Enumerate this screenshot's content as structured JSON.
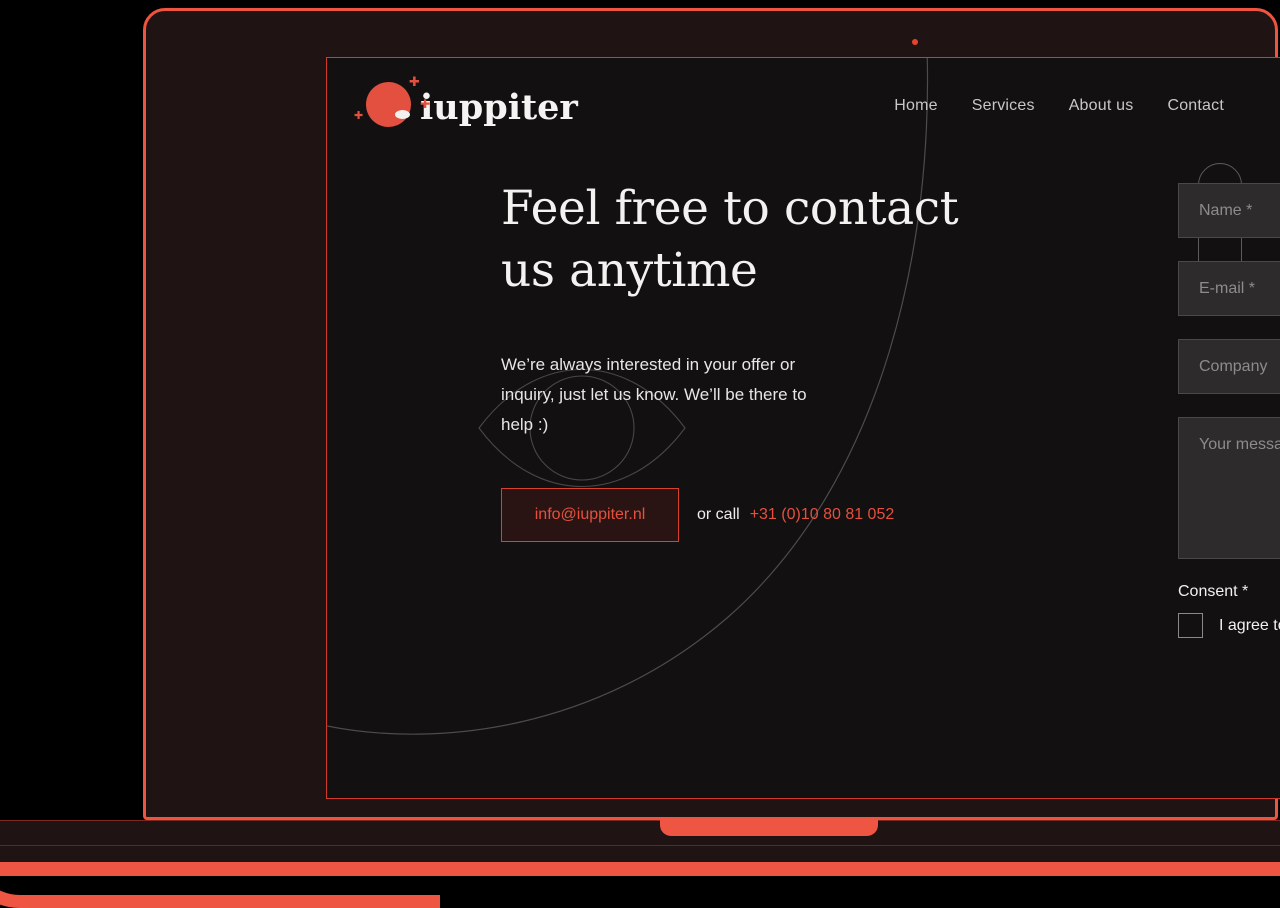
{
  "site": {
    "brand": {
      "name": "iuppiter",
      "logo_icon": "planet-icon",
      "sparkle_icon": "sparkle-icon",
      "sparkle_glyph": "✚",
      "accent_color": "#e3503f"
    },
    "nav": {
      "items": [
        {
          "label": "Home"
        },
        {
          "label": "Services"
        },
        {
          "label": "About us"
        },
        {
          "label": "Contact"
        }
      ]
    },
    "hero": {
      "title_line_1": "Feel free to contact",
      "title_line_2": "us anytime",
      "paragraph": "We’re always interested in your offer or inquiry, just let us know. We’ll be there to help :)",
      "email_button_label": "info@iuppiter.nl",
      "or_call_label": "or call",
      "phone_number": "+31 (0)10 80 81 052"
    },
    "form": {
      "name_placeholder": "Name *",
      "email_placeholder": "E-mail *",
      "company_placeholder": "Company",
      "message_placeholder": "Your message *",
      "consent_label": "Consent *",
      "consent_text": "I agree to the privacy pol",
      "checkbox_checked": false
    },
    "colors": {
      "screen_background": "#121011",
      "bezel": "#201314",
      "bezel_stroke": "#ef5440",
      "accent_red": "#e4503d",
      "field_background": "#2d2b2c",
      "field_border": "#4b4849",
      "placeholder_text": "#8d8b8c",
      "nav_text": "#c8c6c6",
      "deco_line": "#5e5b5c"
    },
    "device": {
      "camera_indicator": "camera-dot-icon",
      "trackpad": "trackpad-notch"
    }
  }
}
